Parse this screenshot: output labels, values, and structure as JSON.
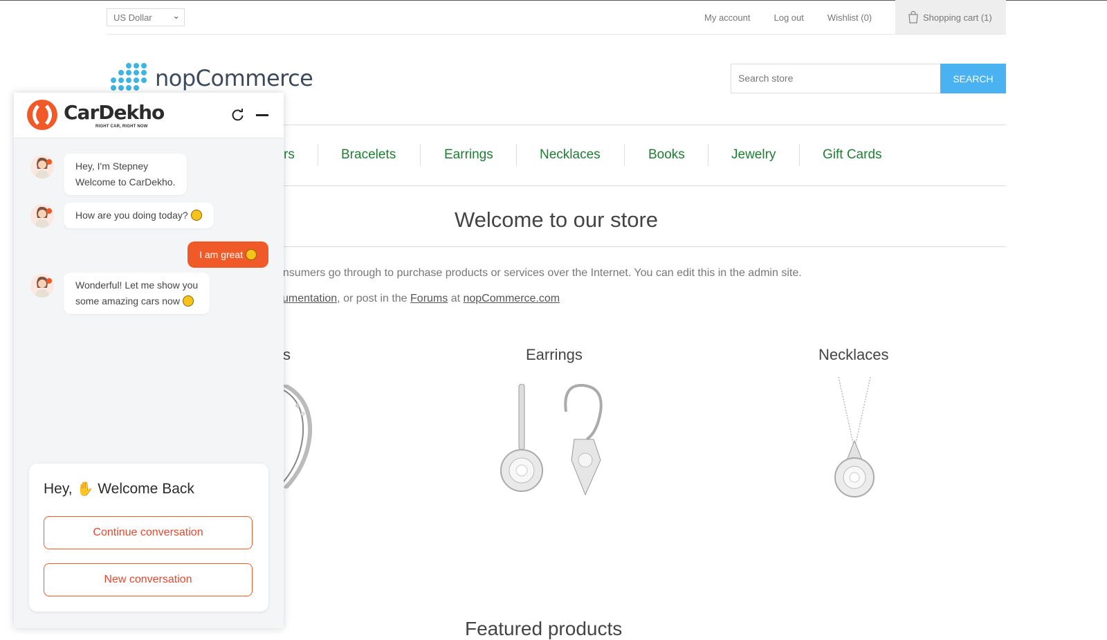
{
  "header": {
    "currency": "US Dollar",
    "links": [
      "My account",
      "Log out",
      "Wishlist (0)"
    ],
    "cart_label": "Shopping cart (1)"
  },
  "logo": {
    "text": "nopCommerce"
  },
  "search": {
    "placeholder": "Search store",
    "button": "SEARCH"
  },
  "nav": {
    "partial_first": "rs",
    "items": [
      "Bracelets",
      "Earrings",
      "Necklaces",
      "Books",
      "Jewelry",
      "Gift Cards"
    ]
  },
  "main": {
    "title": "Welcome to our store",
    "line1": "onsumers go through to purchase products or services over the Internet. You can edit this in the admin site.",
    "line2_link1": "cumentation",
    "line2_mid1": ", or post in the ",
    "line2_link2": "Forums",
    "line2_mid2": " at ",
    "line2_link3": "nopCommerce.com",
    "categories": [
      "s",
      "Earrings",
      "Necklaces"
    ],
    "featured_title": "Featured products"
  },
  "chat": {
    "brand": "CarDekho",
    "tagline": "RIGHT CAR, RIGHT NOW",
    "messages": {
      "bot1_line1": "Hey, I'm Stepney",
      "bot1_line2": "Welcome to CarDekho.",
      "bot2": "How are you doing today?",
      "user1": "I am great",
      "bot3_line1": "Wonderful! Let me show you",
      "bot3_line2": "some amazing cars now"
    },
    "card": {
      "title_pre": "Hey,",
      "title_post": "Welcome Back",
      "continue_btn": "Continue conversation",
      "new_btn": "New conversation"
    },
    "accent_color": "#f05a28"
  },
  "colors": {
    "nav_link": "#1e7d32",
    "search_button": "#4ab2f1"
  }
}
